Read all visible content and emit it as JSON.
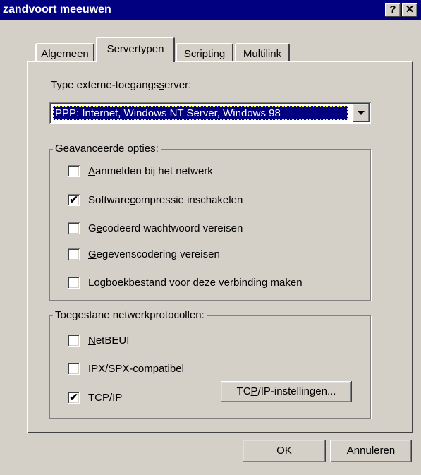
{
  "window": {
    "title": "zandvoort meeuwen",
    "help_glyph": "?",
    "close_glyph": "✕"
  },
  "tabs": [
    {
      "label": "Algemeen"
    },
    {
      "label": "Servertypen",
      "selected": true
    },
    {
      "label": "Scripting"
    },
    {
      "label": "Multilink"
    }
  ],
  "server_type": {
    "label_pre": "Type externe-toegangs",
    "label_u": "s",
    "label_post": "erver:",
    "selected": "PPP: Internet, Windows NT Server, Windows 98"
  },
  "advanced": {
    "title": "Geavanceerde opties:",
    "items": [
      {
        "pre": "",
        "u": "A",
        "post": "anmelden bij het netwerk",
        "checked": false
      },
      {
        "pre": "Software",
        "u": "c",
        "post": "ompressie inschakelen",
        "checked": true
      },
      {
        "pre": "G",
        "u": "e",
        "post": "codeerd wachtwoord vereisen",
        "checked": false
      },
      {
        "pre": "",
        "u": "G",
        "post": "egevenscodering vereisen",
        "checked": false
      },
      {
        "pre": "",
        "u": "L",
        "post": "ogboekbestand voor deze verbinding maken",
        "checked": false
      }
    ]
  },
  "protocols": {
    "title": "Toegestane netwerkprotocollen:",
    "items": [
      {
        "pre": "",
        "u": "N",
        "post": "etBEUI",
        "checked": false
      },
      {
        "pre": "",
        "u": "I",
        "post": "PX/SPX-compatibel",
        "checked": false
      },
      {
        "pre": "",
        "u": "T",
        "post": "CP/IP",
        "checked": true
      }
    ],
    "tcpip_button": {
      "pre": "TC",
      "u": "P",
      "post": "/IP-instellingen..."
    }
  },
  "buttons": {
    "ok": "OK",
    "cancel": "Annuleren"
  },
  "check_glyph": "✔"
}
